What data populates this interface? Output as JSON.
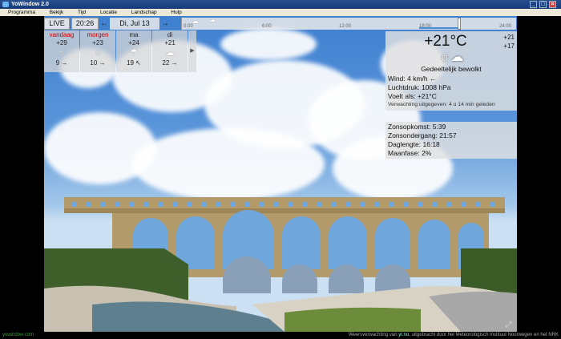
{
  "window": {
    "title": "YoWindow 2.0"
  },
  "menu": [
    "Programma",
    "Bekijk",
    "Tijd",
    "Locatie",
    "Landschap",
    "Hulp"
  ],
  "toolbar": {
    "live_label": "LIVE",
    "time": "20:26",
    "date": "Di, Jul 13",
    "prev_arrow": "←",
    "next_arrow": "→"
  },
  "timeline": {
    "ticks": [
      "0:00",
      "6:00",
      "12:00",
      "18:00",
      "24:00"
    ]
  },
  "days": [
    {
      "name": "vandaag",
      "high": "+29",
      "low": "9",
      "wind_arrow": "→",
      "icon": "☼"
    },
    {
      "name": "morgen",
      "high": "+23",
      "low": "10",
      "wind_arrow": "→",
      "icon": "☼"
    },
    {
      "name": "ma",
      "high": "+24",
      "low": "19",
      "wind_arrow": "↖",
      "icon": "☂"
    },
    {
      "name": "di",
      "high": "+21",
      "low": "22",
      "wind_arrow": "→",
      "icon": "☁"
    }
  ],
  "current": {
    "temperature": "+21°C",
    "high": "+21",
    "low": "+17",
    "description": "Gedeeltelijk bewolkt",
    "wind_label": "Wind:",
    "wind_value": "4 km/h ←",
    "pressure_label": "Luchtdruk:",
    "pressure_value": "1008 hPa",
    "feels_label": "Voelt als:",
    "feels_value": "+21°C",
    "issued_label": "Verwachting uitgegeven:",
    "issued_value": "4 u 14 min geleden"
  },
  "sun": {
    "sunrise_label": "Zonsopkomst:",
    "sunrise_value": "5:39",
    "sunset_label": "Zonsondergang:",
    "sunset_value": "21:57",
    "daylength_label": "Daglengte:",
    "daylength_value": "16:18",
    "moon_label": "Maanfase:",
    "moon_value": "2%"
  },
  "status": {
    "site": "yowindow.com",
    "credit_prefix": "Weersverwachting van ",
    "credit_link": "yr.no",
    "credit_suffix": ", uitgebracht door het Meteorologisch Instituut Noorwegen en het NRK"
  },
  "colors": {
    "sky": "#4a88d4",
    "panel": "#e1e1e1",
    "today_label": "#cc0000"
  }
}
